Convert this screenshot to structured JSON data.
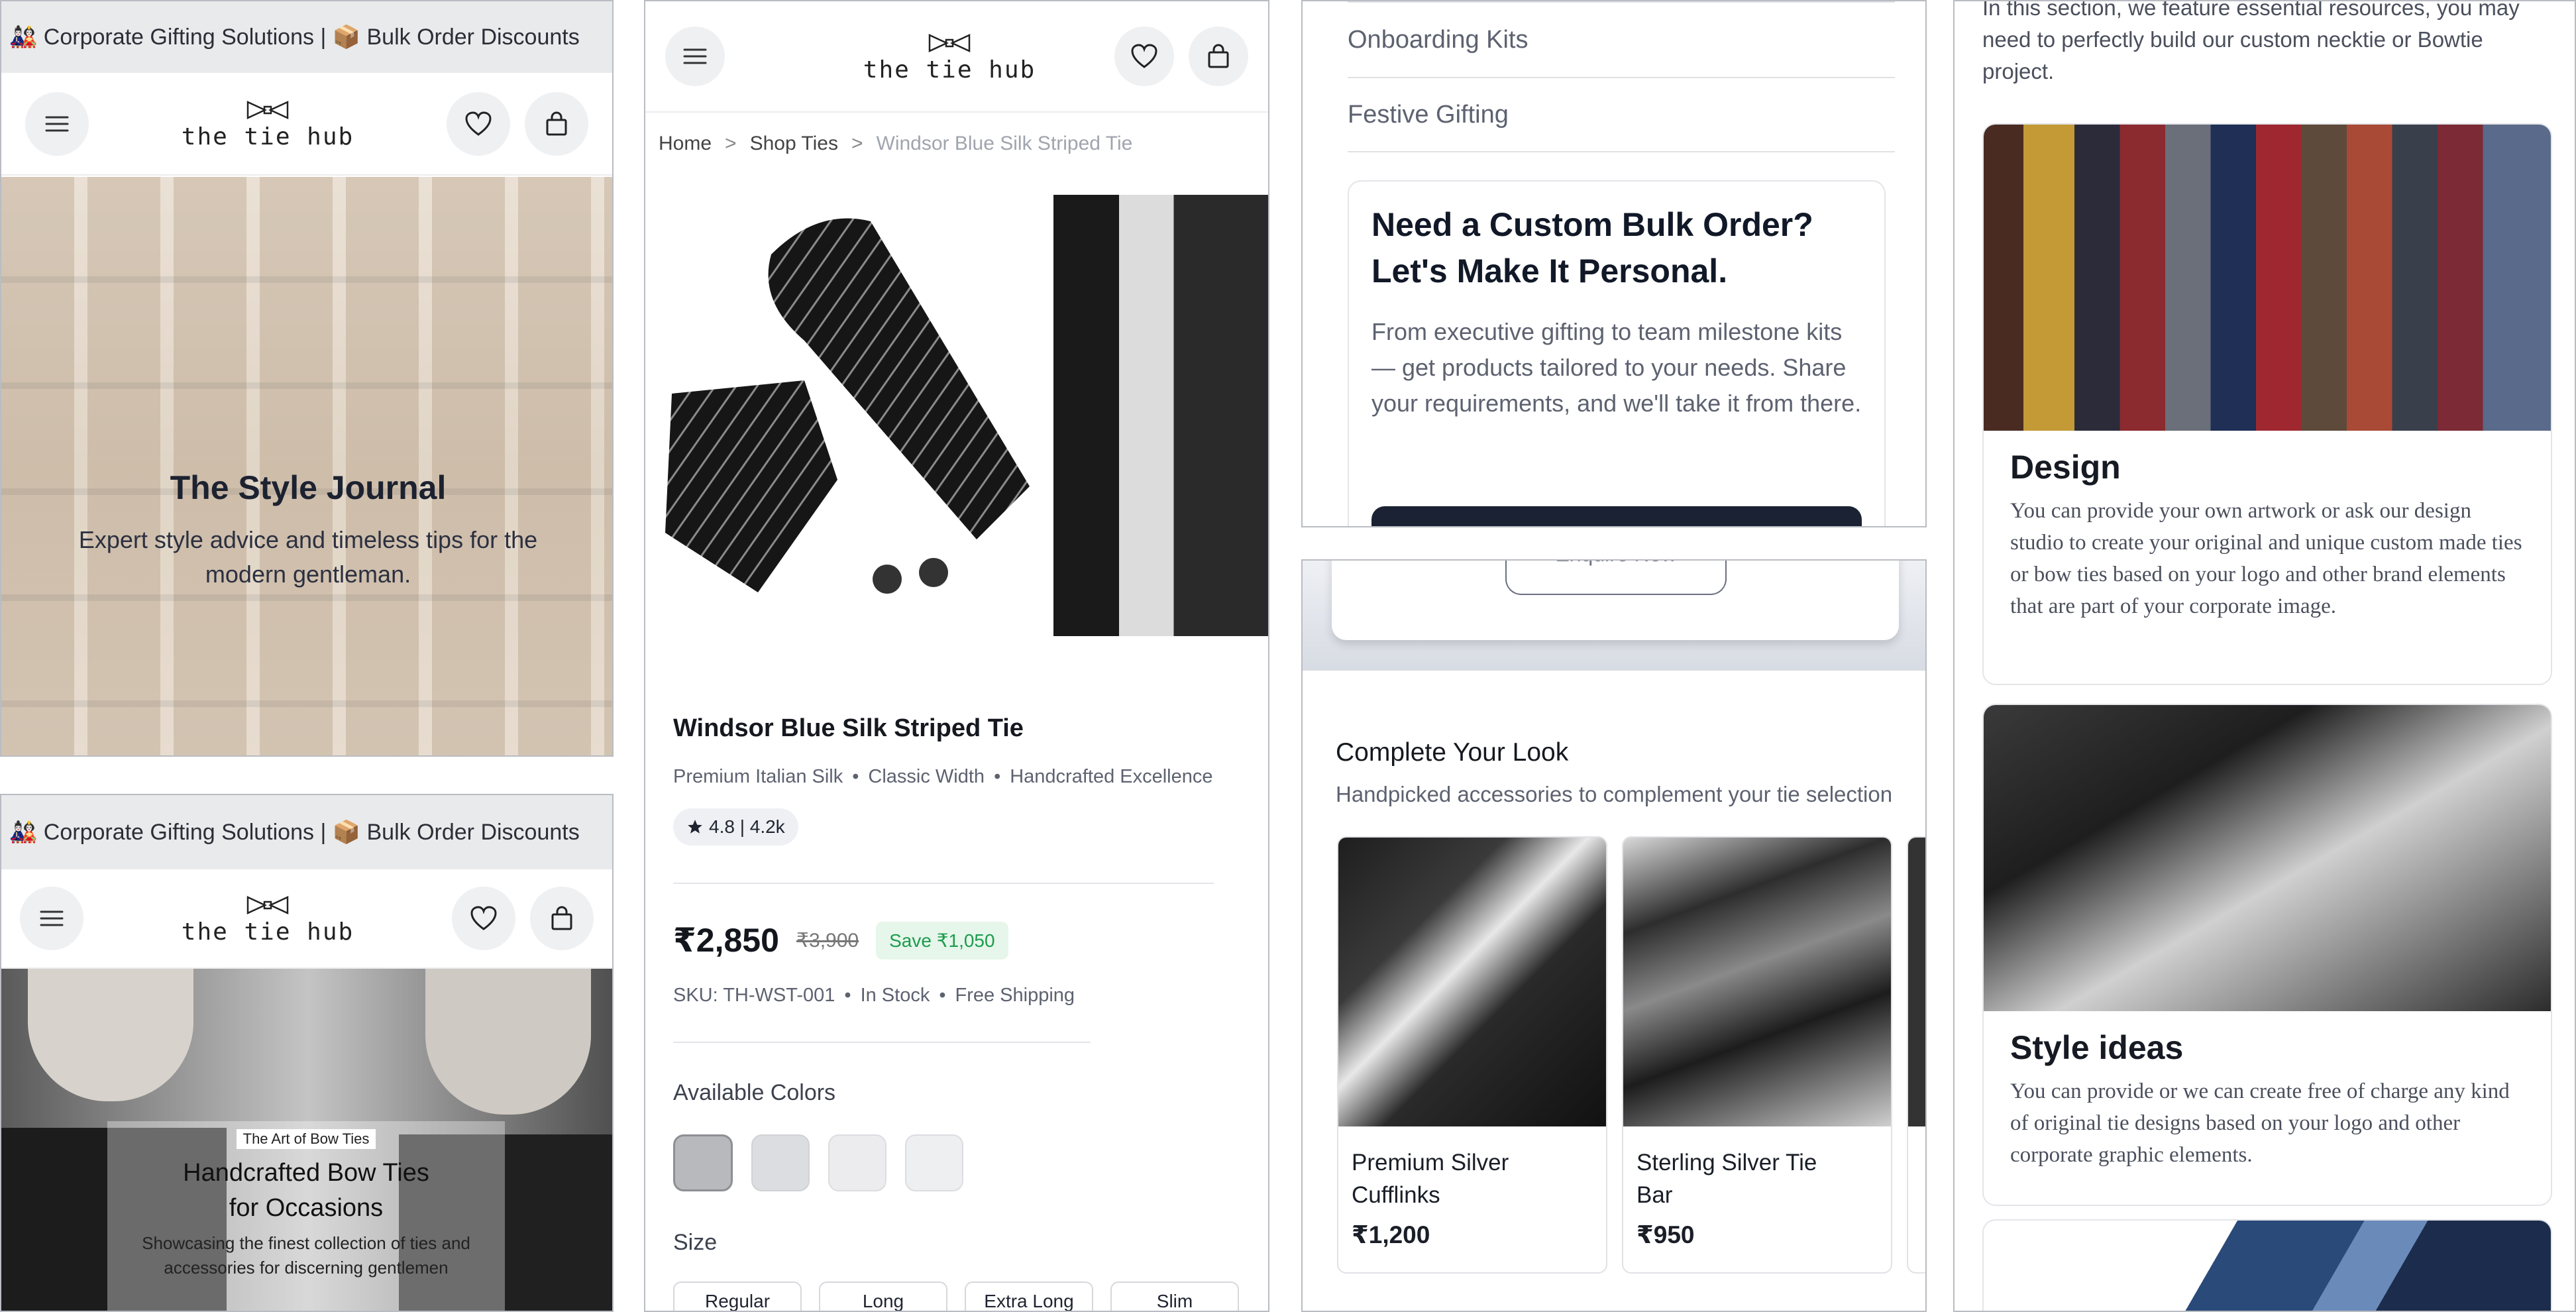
{
  "screen1": {
    "top_banner": "🎎 Corporate Gifting Solutions | 📦 Bulk Order Discounts",
    "logo_text": "the tie hub",
    "hero_title": "The Style Journal",
    "hero_subtitle": "Expert style advice and timeless tips for the modern gentleman."
  },
  "screen2": {
    "top_banner": "🎎 Corporate Gifting Solutions | 📦 Bulk Order Discounts",
    "logo_text": "the tie hub",
    "hero_kicker": "The Art of Bow Ties",
    "hero_title": "Handcrafted Bow Ties for Occasions",
    "hero_subtitle": "Showcasing the finest collection of ties and accessories for discerning gentlemen"
  },
  "screen3": {
    "logo_text": "the tie hub",
    "breadcrumb": [
      "Home",
      "Shop Ties",
      "Windsor Blue Silk Striped Tie"
    ],
    "breadcrumb_sep": ">",
    "product_name": "Windsor Blue Silk Striped Tie",
    "features": [
      "Premium Italian Silk",
      "Classic Width",
      "Handcrafted Excellence"
    ],
    "rating": "4.8 | 4.2k",
    "price": "₹2,850",
    "old_price": "₹3,900",
    "save_badge": "Save ₹1,050",
    "sku_line": [
      "SKU: TH-WST-001",
      "In Stock",
      "Free Shipping"
    ],
    "colors_label": "Available Colors",
    "size_label": "Size",
    "sizes": [
      "Regular",
      "Long",
      "Extra Long",
      "Slim"
    ]
  },
  "screen4": {
    "menu_items": [
      "Onboarding Kits",
      "Festive Gifting"
    ],
    "card_title": "Need a Custom Bulk Order? Let's Make It Personal.",
    "card_body": "From executive gifting to team milestone kits — get products tailored to your needs. Share your requirements, and we'll take it from there."
  },
  "screen5": {
    "enquire_label": "Enquire Now",
    "section_title": "Complete Your Look",
    "section_subtitle": "Handpicked accessories to complement your tie selection",
    "products": [
      {
        "name": "Premium Silver Cufflinks",
        "price": "₹1,200"
      },
      {
        "name": "Sterling Silver Tie Bar",
        "price": "₹950"
      }
    ]
  },
  "screen6": {
    "intro": "In this section, we feature essential resources, you may need to perfectly build our custom necktie or Bowtie project.",
    "cards": [
      {
        "title": "Design",
        "body": "You can provide your own artwork or ask our design studio to create your original and unique custom made ties or bow ties based on your logo and other brand elements that are part of your corporate image."
      },
      {
        "title": "Style ideas",
        "body": "You can provide or we can create free of charge any kind of original tie designs based on your logo and other corporate graphic elements."
      }
    ]
  },
  "colors": {
    "accent_green": "#1d9b4f",
    "save_bg": "#e6f6ea",
    "dark_button": "#1a2233",
    "swatches": [
      "#b8b9bd",
      "#dcdde0",
      "#ececee",
      "#eeeff1"
    ]
  },
  "icons": [
    "menu-icon",
    "heart-icon",
    "bag-icon",
    "bow-tie-logo-icon",
    "star-icon"
  ]
}
